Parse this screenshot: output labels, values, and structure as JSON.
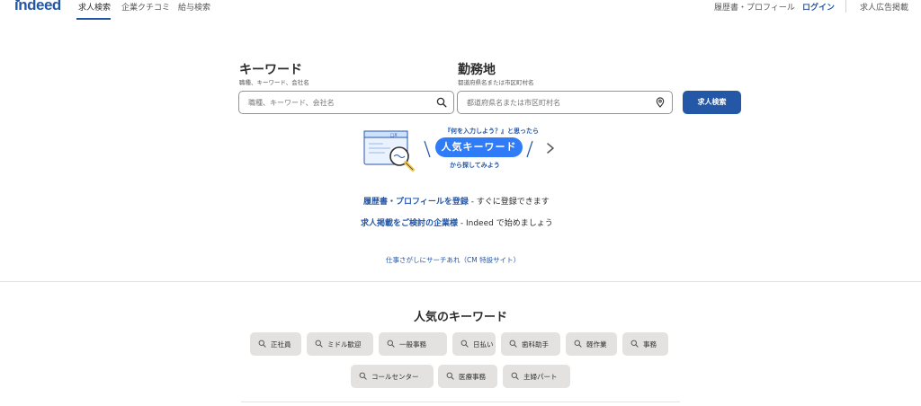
{
  "header": {
    "logo": "indeed",
    "nav": [
      "求人検索",
      "企業クチコミ",
      "給与検索"
    ],
    "right": {
      "resume": "履歴書・プロフィール",
      "login": "ログイン",
      "employer": "求人広告掲載"
    }
  },
  "search": {
    "keyword": {
      "title": "キーワード",
      "sub": "職種、キーワード、会社名",
      "placeholder": "職種、キーワード、会社名",
      "icon": "search-icon"
    },
    "location": {
      "title": "勤務地",
      "sub": "都道府県名または市区町村名",
      "placeholder": "都道府県名または市区町村名",
      "icon": "location-pin-icon"
    },
    "button": "求人検索"
  },
  "banner": {
    "question": "『何を入力しよう？』と思ったら",
    "pill": "人気キーワード",
    "sub": "から探してみよう",
    "window_label": "_□X"
  },
  "links": {
    "resume_link": "履歴書・プロフィールを登録",
    "resume_rest": " - すぐに登録できます",
    "employer_link": "求人掲載をご検討の企業様",
    "employer_rest": " - Indeed で始めましょう",
    "cm_link": "仕事さがしにサーチあれ（CM 特設サイト）"
  },
  "popular": {
    "title": "人気のキーワード",
    "row1": [
      "正社員",
      "ミドル歓迎",
      "一般事務",
      "日払い",
      "歯科助手",
      "軽作業",
      "事務"
    ],
    "row2": [
      "コールセンター",
      "医療事務",
      "主婦パート"
    ]
  },
  "colors": {
    "brand": "#2557a7",
    "pill": "#2f7cf6",
    "chip_bg": "#e4e2e0",
    "text": "#2d2d2d"
  }
}
